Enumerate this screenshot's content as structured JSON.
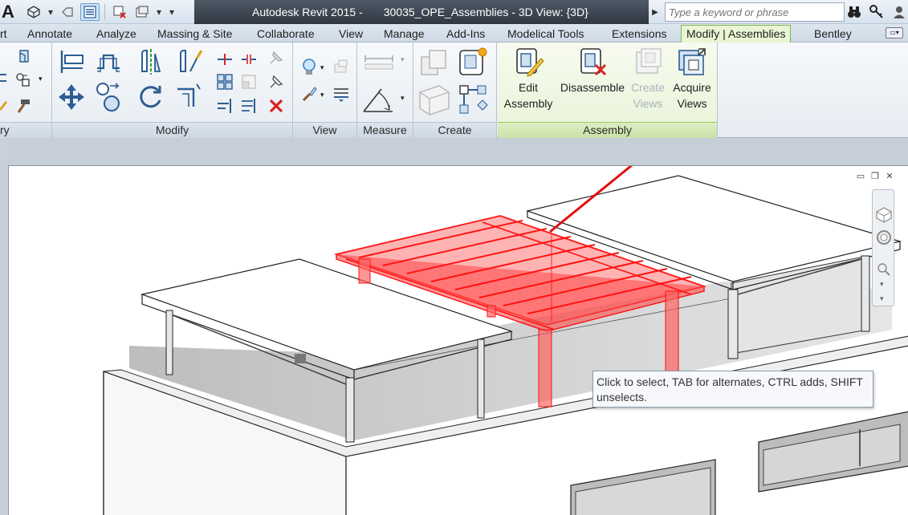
{
  "app": {
    "logo": "A",
    "title": "Autodesk Revit 2015 -",
    "document": "30035_OPE_Assemblies - 3D View: {3D}"
  },
  "search": {
    "placeholder": "Type a keyword or phrase"
  },
  "tabs": [
    {
      "label": "rt"
    },
    {
      "label": "Annotate"
    },
    {
      "label": "Analyze"
    },
    {
      "label": "Massing & Site"
    },
    {
      "label": "Collaborate"
    },
    {
      "label": "View"
    },
    {
      "label": "Manage"
    },
    {
      "label": "Add-Ins"
    },
    {
      "label": "Modelical Tools"
    },
    {
      "label": "Extensions"
    },
    {
      "label": "Modify | Assemblies",
      "active": true
    },
    {
      "label": "Bentley"
    }
  ],
  "panels": {
    "clipboard": "ry",
    "modify": "Modify",
    "view": "View",
    "measure": "Measure",
    "create": "Create",
    "assembly": "Assembly"
  },
  "assembly_buttons": {
    "edit": {
      "line1": "Edit",
      "line2": "Assembly"
    },
    "disassemble": {
      "line1": "Disassemble"
    },
    "create_views": {
      "line1": "Create",
      "line2": "Views",
      "enabled": false
    },
    "acquire_views": {
      "line1": "Acquire",
      "line2": "Views"
    }
  },
  "tooltip": {
    "line1": "Click to select, TAB for alternates, CTRL adds, SHIFT",
    "line2": "unselects."
  },
  "colors": {
    "selection_red": "#ff0000",
    "active_tab_green": "#7dbb4a",
    "title_bar_dark": "#2f3742"
  }
}
